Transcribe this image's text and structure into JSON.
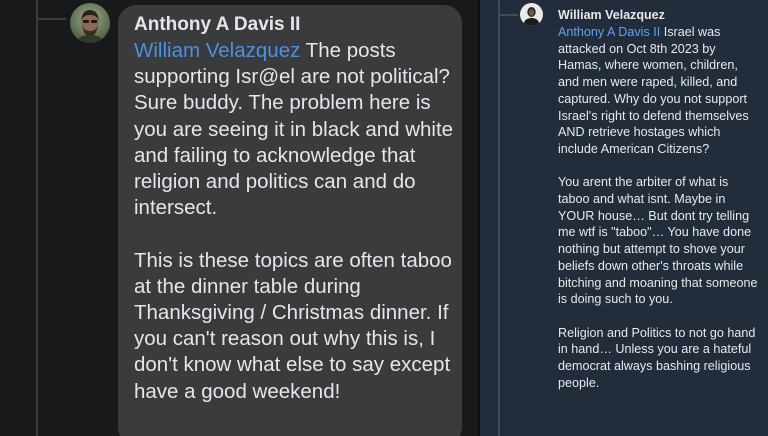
{
  "left_comment": {
    "author": "Anthony A Davis II",
    "mention": "William Velazquez",
    "text": " The posts supporting Isr@el are not political? Sure buddy. The problem here is you are seeing it in black and white and failing to acknowledge that religion and politics can and do intersect.\n\nThis is these topics are often taboo at the dinner table during Thanksgiving / Christmas dinner. If you can't reason out why this is, I don't know what else to say except have a good weekend!"
  },
  "right_comment": {
    "author": "William Velazquez",
    "mention": "Anthony A Davis II",
    "text": " Israel was attacked on Oct 8th 2023 by Hamas, where women, children, and men were raped, killed, and captured. Why do you not support Israel's right to defend themselves AND retrieve hostages which include American Citizens?\n\nYou arent the arbiter of what is taboo and what isnt. Maybe in YOUR house… But dont try telling me wtf is \"taboo\"… You have done nothing but attempt to shove your beliefs down other's throats while bitching and moaning that someone is doing such to you.\n\nReligion and Politics to not go hand in hand… Unless you are a hateful democrat always bashing religious people."
  },
  "colors": {
    "left_bubble": "#3a3b3c",
    "right_background": "#222c3a",
    "mention_link": "#4e8fe3"
  }
}
